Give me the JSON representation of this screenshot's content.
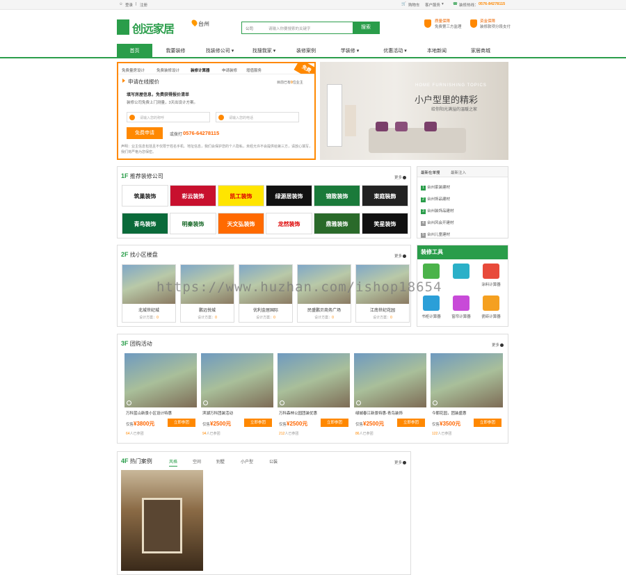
{
  "topbar": {
    "login": "登录",
    "register": "注册",
    "cart": "购物车",
    "service": "客户服务",
    "hotline_label": "装修热线：",
    "hotline": "0576-84278115"
  },
  "header": {
    "logo_text": "创远家居",
    "city": "台州",
    "search_select": "公司",
    "search_placeholder": "请输入你要搜索的关键字",
    "search_button": "搜索",
    "promise1_title": "质量保障",
    "promise1_sub": "免费第三方监理",
    "promise2_title": "资金保障",
    "promise2_sub": "装修款项分段支付"
  },
  "nav": [
    "首页",
    "我要装修",
    "找装修公司",
    "找搜我家",
    "装修案例",
    "学装修",
    "优惠活动",
    "本地新闻",
    "家居商城"
  ],
  "free": {
    "tabs": [
      "免费量房设计",
      "免费装修设计",
      "装修计算器",
      "申请装修",
      "增值服务"
    ],
    "ribbon": "免费",
    "heading": "申请在线报价",
    "count_prefix": "目前已有",
    "count": "0",
    "count_suffix": "位业主",
    "line1": "填写房屋信息，免费获得报价清单",
    "line2": "装修公司免费上门测量，3天出设计方案。",
    "name_ph": "请输入您的称呼",
    "phone_ph": "请输入您的电话",
    "apply": "免费申请",
    "or_call": "或拨打",
    "phone": "0576-64278115",
    "note": "声明：业主信息包括且不仅限于姓名手机、地址信息，我们会保护您的个人隐私，未经允许不会提供给第三方，请放心填写，我们将严格为您保密。"
  },
  "banner": {
    "en": "HOME FURNISHING TOPICS",
    "title": "小户型里的精彩",
    "sub": "给你阳光满溢的温暖之家"
  },
  "sec1": {
    "floor": "1F",
    "title": "推荐装修公司",
    "more": "更多",
    "logos": [
      {
        "text": "筑巢装饰",
        "bg": "#ffffff",
        "fg": "#222"
      },
      {
        "text": "彩云装饰",
        "bg": "#c8102e",
        "fg": "#fff"
      },
      {
        "text": "凯工装饰",
        "bg": "#ffe500",
        "fg": "#d00"
      },
      {
        "text": "绿源居装饰",
        "bg": "#111111",
        "fg": "#fff"
      },
      {
        "text": "锦致装饰",
        "bg": "#1a7a3a",
        "fg": "#fff"
      },
      {
        "text": "東庭裝飾",
        "bg": "#222222",
        "fg": "#fff"
      },
      {
        "text": "青鸟装饰",
        "bg": "#0a6a3a",
        "fg": "#fff"
      },
      {
        "text": "明秦装饰",
        "bg": "#ffffff",
        "fg": "#1a6a2a"
      },
      {
        "text": "天文弘装饰",
        "bg": "#ff6a00",
        "fg": "#fff"
      },
      {
        "text": "龙然装饰",
        "bg": "#ffffff",
        "fg": "#d00"
      },
      {
        "text": "鼎雅装饰",
        "bg": "#2a6a2a",
        "fg": "#fff"
      },
      {
        "text": "笑星装饰",
        "bg": "#111111",
        "fg": "#fff"
      }
    ]
  },
  "ranking": {
    "tab1": "最新在单搜",
    "tab2": "最新注入",
    "items": [
      "台州家装建材",
      "台州饰品建材",
      "台州装饰品建材",
      "台州风会开建材",
      "台州儿童建材"
    ]
  },
  "sec2": {
    "floor": "2F",
    "title": "找小区楼盘",
    "more": "更多",
    "items": [
      {
        "name": "北城世纪城",
        "cnt": "0"
      },
      {
        "name": "鹏远悦城",
        "cnt": "0"
      },
      {
        "name": "优利金居国际",
        "cnt": "0"
      },
      {
        "name": "民盛鹏贝商务广场",
        "cnt": "0"
      },
      {
        "name": "江南世纪花园",
        "cnt": "0"
      }
    ],
    "cnt_label": "设计方案："
  },
  "tools": {
    "title": "装修工具",
    "items": [
      {
        "name": "",
        "color": "#4bb34a"
      },
      {
        "name": "",
        "color": "#2bb0c8"
      },
      {
        "name": "涂料计算器",
        "color": "#e84a3a"
      },
      {
        "name": "书柜计算器",
        "color": "#2b9fd8"
      },
      {
        "name": "窗帘计算器",
        "color": "#c84ad8"
      },
      {
        "name": "瓷砖计算器",
        "color": "#f5a020"
      }
    ]
  },
  "sec3": {
    "floor": "3F",
    "title": "团购活动",
    "more": "更多",
    "price_label": "仅售",
    "btn": "立即参团",
    "joined": "人已参团",
    "items": [
      {
        "name": "万科蓝山新景小区设计特惠",
        "price": "¥3800元",
        "n": "64"
      },
      {
        "name": "滨湖万科团装活动",
        "price": "¥2500元",
        "n": "94"
      },
      {
        "name": "万科森林公园团装优惠",
        "price": "¥2500元",
        "n": "212"
      },
      {
        "name": "绿城春江新景特惠-青鸟装饰",
        "price": "¥2500元",
        "n": "86"
      },
      {
        "name": "今朝花园，团装盛惠",
        "price": "¥3500元",
        "n": "122"
      }
    ]
  },
  "sec4": {
    "floor": "4F",
    "title": "热门案例",
    "tabs": [
      "风格",
      "空间",
      "别墅",
      "小户型",
      "公装"
    ],
    "more": "更多"
  },
  "watermark": "https://www.huzhan.com/ishop18654"
}
